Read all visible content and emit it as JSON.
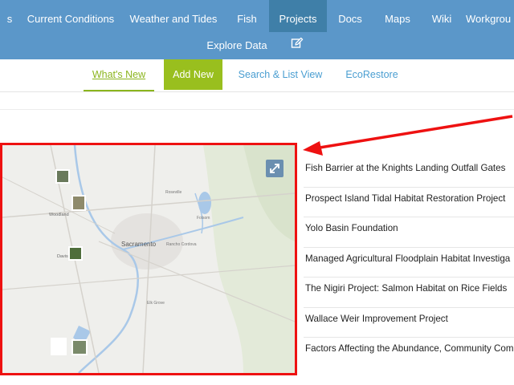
{
  "nav": {
    "row1": [
      {
        "label": "s",
        "active": false
      },
      {
        "label": "Current Conditions",
        "active": false
      },
      {
        "label": "Weather and Tides",
        "active": false
      },
      {
        "label": "Fish",
        "active": false
      },
      {
        "label": "Projects",
        "active": true
      },
      {
        "label": "Docs",
        "active": false
      },
      {
        "label": "Maps",
        "active": false
      },
      {
        "label": "Wiki",
        "active": false
      },
      {
        "label": "Workgrou",
        "active": false
      }
    ],
    "row2": [
      {
        "label": "Explore Data"
      }
    ],
    "edit_icon": "edit-icon"
  },
  "tabs": {
    "whats_new": "What's New",
    "add_new": "Add New",
    "search_list": "Search & List View",
    "ecorestore": "EcoRestore"
  },
  "map": {
    "labels": {
      "sacramento": "Sacramento",
      "woodland": "Woodland",
      "davis": "Davis",
      "elk_grove": "Elk Grove",
      "roseville": "Roseville",
      "folsom": "Folsom",
      "rancho": "Rancho Cordova"
    },
    "expand_icon": "expand-icon"
  },
  "projects": [
    "Fish Barrier at the Knights Landing Outfall Gates",
    "Prospect Island Tidal Habitat Restoration Project",
    "Yolo Basin Foundation",
    "Managed Agricultural Floodplain Habitat Investiga",
    "The Nigiri Project: Salmon Habitat on Rice Fields",
    "Wallace Weir Improvement Project",
    "Factors Affecting the Abundance, Community Com"
  ],
  "colors": {
    "nav_bg": "#5b97c9",
    "nav_active": "#3f7fa8",
    "accent_green": "#99bf1e",
    "link_blue": "#4a9ed1",
    "highlight_red": "#ee1111"
  }
}
